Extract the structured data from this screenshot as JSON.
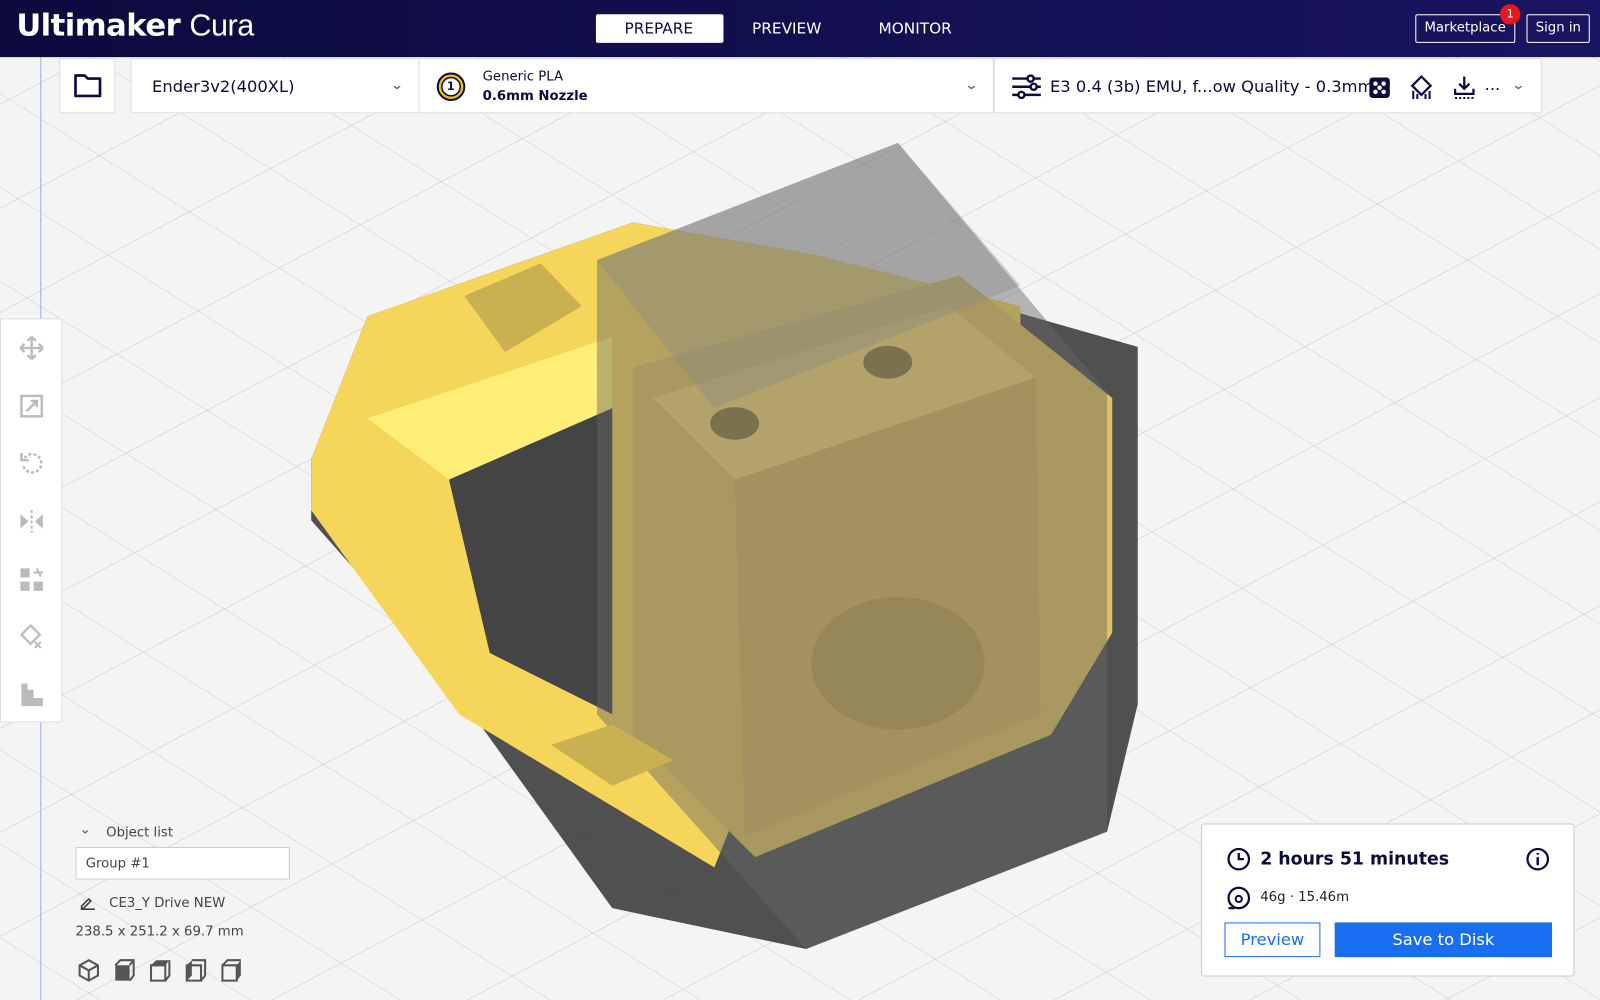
{
  "app": {
    "brand_bold": "Ultimaker",
    "brand_light": "Cura"
  },
  "tabs": [
    {
      "label": "PREPARE",
      "active": true
    },
    {
      "label": "PREVIEW"
    },
    {
      "label": "MONITOR"
    }
  ],
  "header": {
    "marketplace": "Marketplace",
    "marketplace_badge": "1",
    "sign_in": "Sign in"
  },
  "toolbar": {
    "printer": "Ender3v2(400XL)",
    "extruder_number": "1",
    "material": "Generic PLA",
    "nozzle": "0.6mm Nozzle",
    "profile": "E3 0.4 (3b) EMU, f...ow Quality - 0.3mm",
    "more": "..."
  },
  "left_tools": [
    "move-icon",
    "scale-icon",
    "rotate-icon",
    "mirror-icon",
    "per-model-settings-icon",
    "support-blocker-icon",
    "layer-icon"
  ],
  "object_panel": {
    "title": "Object list",
    "selected": "Group #1",
    "object_name": "CE3_Y Drive NEW",
    "dimensions": "238.5 x 251.2 x 69.7 mm"
  },
  "print_card": {
    "time": "2 hours 51 minutes",
    "material_usage": "46g · 15.46m",
    "preview_label": "Preview",
    "save_label": "Save to Disk"
  },
  "colors": {
    "header": "#0c0a3e",
    "accent": "#196ef0",
    "model": "#f7d960",
    "badge": "#e5181c"
  }
}
